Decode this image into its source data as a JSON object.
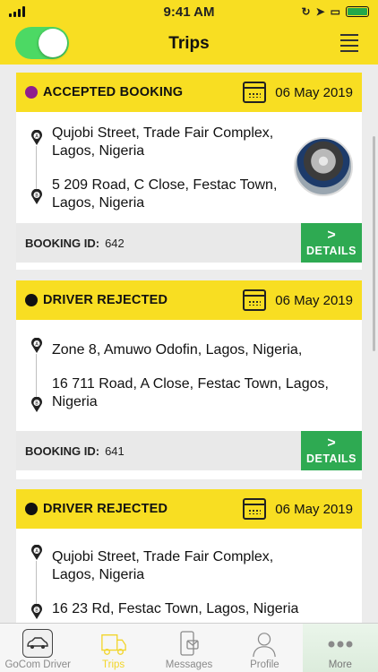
{
  "status_bar": {
    "time": "9:41 AM"
  },
  "header": {
    "title": "Trips"
  },
  "trips": [
    {
      "status": "ACCEPTED BOOKING",
      "status_color": "#8e1e8e",
      "date": "06 May 2019",
      "pickup": "Qujobi Street, Trade Fair Complex, Lagos, Nigeria",
      "dropoff": "5 209 Road, C Close, Festac Town, Lagos, Nigeria",
      "booking_label": "BOOKING ID:",
      "booking_id": "642",
      "details_arrow": ">",
      "details_label": "DETAILS"
    },
    {
      "status": "DRIVER REJECTED",
      "status_color": "#111111",
      "date": "06 May 2019",
      "pickup": "Zone 8, Amuwo Odofin, Lagos, Nigeria,",
      "dropoff": "16 711 Road, A Close, Festac Town, Lagos, Nigeria",
      "booking_label": "BOOKING ID:",
      "booking_id": "641",
      "details_arrow": ">",
      "details_label": "DETAILS"
    },
    {
      "status": "DRIVER REJECTED",
      "status_color": "#111111",
      "date": "06 May 2019",
      "pickup": "Qujobi Street, Trade Fair Complex, Lagos, Nigeria",
      "dropoff": "16 23 Rd, Festac Town, Lagos, Nigeria"
    }
  ],
  "tabs": [
    {
      "label": "GoCom Driver",
      "icon": "car-icon"
    },
    {
      "label": "Trips",
      "icon": "truck-icon"
    },
    {
      "label": "Messages",
      "icon": "phone-message-icon"
    },
    {
      "label": "Profile",
      "icon": "profile-icon"
    },
    {
      "label": "More",
      "icon": "more-icon"
    }
  ],
  "colors": {
    "accent": "#f8de22",
    "details": "#2eaa52",
    "toggle": "#4cd964"
  }
}
